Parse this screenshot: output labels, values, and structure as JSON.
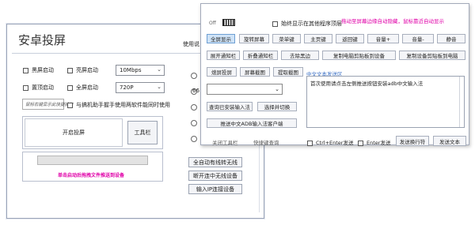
{
  "main": {
    "title": "安卓投屏",
    "options": {
      "black_screen_boot": "黑屏启动",
      "bright_screen_boot": "亮屏启动",
      "topmost_boot": "置顶启动",
      "fullscreen_boot": "全屏启动",
      "bitrate_value": "10Mbps",
      "resolution_value": "720P",
      "note_text": "鼠标右键显示此快捷操作",
      "kill_shortcut_label": "与搞机助手握手使用两软件能同时使用"
    },
    "buttons": {
      "start_cast": "开启投屏",
      "toolbar": "工具栏",
      "auto_wireless": "全自动有线转无线",
      "open_wireless_debug": "断开连中无线设备",
      "input_ip": "输入IP连接设备"
    },
    "drop_hint": "单击启动后拖拽文件推送到设备",
    "side": {
      "usage_label": "使用说",
      "ip_prefix": "66"
    }
  },
  "toolbar": {
    "off_label": "Off",
    "always_on_top_label": "始终显示在其他程序顶层",
    "magenta_hint": "拖动至屏幕边缘自动隐藏，鼠标靠近自动显示",
    "buttons_row1": [
      "全屏显示",
      "旋转屏幕",
      "菜单键",
      "主页键",
      "返回键",
      "音量+",
      "音量-",
      "静音"
    ],
    "buttons_row2": [
      "展开通知栏",
      "折叠通知栏",
      "去除黑边",
      "复制电脑剪贴板到设备",
      "复制设备剪贴板到电脑"
    ],
    "buttons_row3": [
      "熄屏投屏",
      "屏幕截图",
      "提取截图"
    ],
    "cn_label": "中文文本发送区",
    "cn_text": "首次使用请点击左侧推送按钮安装adb中文输入法",
    "query_ime": "查询已安装输入法",
    "select_switch": "选择并切换",
    "push_adb_ime": "推送中文ADB输入法客户端",
    "close_toolbar": "关闭工具栏",
    "shortcut_query": "快捷键查询",
    "ctrl_enter_label": "Ctrl+Enter发送",
    "enter_label": "Enter发送",
    "send_newline": "发送换行符",
    "send_text": "发送文本"
  },
  "colors": {
    "accent_magenta": "#e000a8",
    "accent_blue": "#3a6fc4",
    "active_button": "#cfe3f7"
  }
}
